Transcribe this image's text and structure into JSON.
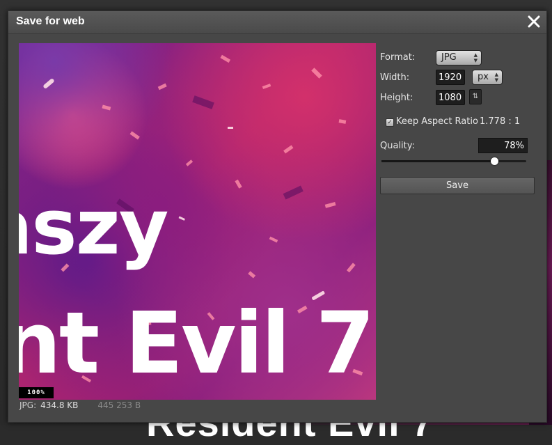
{
  "dialog": {
    "title": "Save for web",
    "close_glyph": "×"
  },
  "preview": {
    "line1": "aszy",
    "line2": "nt Evil 7",
    "zoom": "100%",
    "background_text": "Resident Evil 7"
  },
  "file_info": {
    "format": "JPG:",
    "size_kb": "434.8 KB",
    "size_bytes": "445 253 B"
  },
  "settings": {
    "format_label": "Format:",
    "format_value": "JPG",
    "width_label": "Width:",
    "width_value": "1920",
    "unit_value": "px",
    "height_label": "Height:",
    "height_value": "1080",
    "swap_glyph": "⇅",
    "keep_aspect_label": "Keep Aspect Ratio",
    "keep_aspect_checked": true,
    "aspect_ratio": "1.778 : 1",
    "quality_label": "Quality:",
    "quality_value": "78%",
    "quality_level": 0.78,
    "save_label": "Save"
  },
  "icons": {
    "close": "close-icon",
    "select_arrows": "updown-arrows-icon",
    "swap": "swap-dimensions-icon",
    "check": "checkmark-icon"
  }
}
